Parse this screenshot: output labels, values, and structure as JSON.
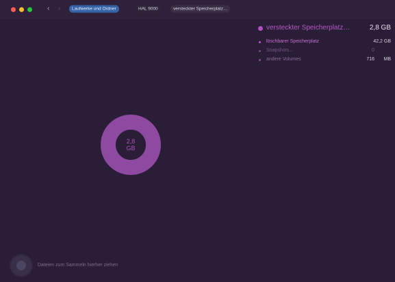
{
  "window": {
    "traffic_lights": [
      {
        "name": "close",
        "color": "#ff5f57"
      },
      {
        "name": "minimize",
        "color": "#febc2e"
      },
      {
        "name": "maximize",
        "color": "#28c840"
      }
    ]
  },
  "nav": {
    "back_icon": "chevron-left-icon",
    "back_glyph": "‹",
    "forward_icon": "chevron-right-icon",
    "forward_glyph": "›"
  },
  "breadcrumbs": [
    {
      "label": "Laufwerke und Ordner",
      "active": true
    },
    {
      "label": "HAL 9000",
      "active": false
    },
    {
      "label": "versteckter Speicherplatz…",
      "active": false
    }
  ],
  "legend": {
    "main": {
      "label": "versteckter Speicherplatz…",
      "value": "2,8 GB",
      "color": "#b14fc0"
    },
    "rows": [
      {
        "label": "löschbarer Speicherplatz",
        "value": "42,2 GB",
        "unit": "",
        "color": "#c94dd0",
        "label_color": "#c46fd0"
      },
      {
        "label": "Snapshots…",
        "value": "0",
        "unit": "",
        "color": "#7a4a8a",
        "label_color": "#7a5788"
      },
      {
        "label": "andere Volumes",
        "value": "716",
        "unit": "MB",
        "color": "#8a4fa0",
        "label_color": "#8d6a9a"
      }
    ]
  },
  "donut": {
    "value_line1": "2,8",
    "value_line2": "GB",
    "ring_color": "#8e4aa0",
    "hole_color": "#2a1d37"
  },
  "footer": {
    "drop_hint": "Dateien zum Sammeln hierher ziehen"
  }
}
